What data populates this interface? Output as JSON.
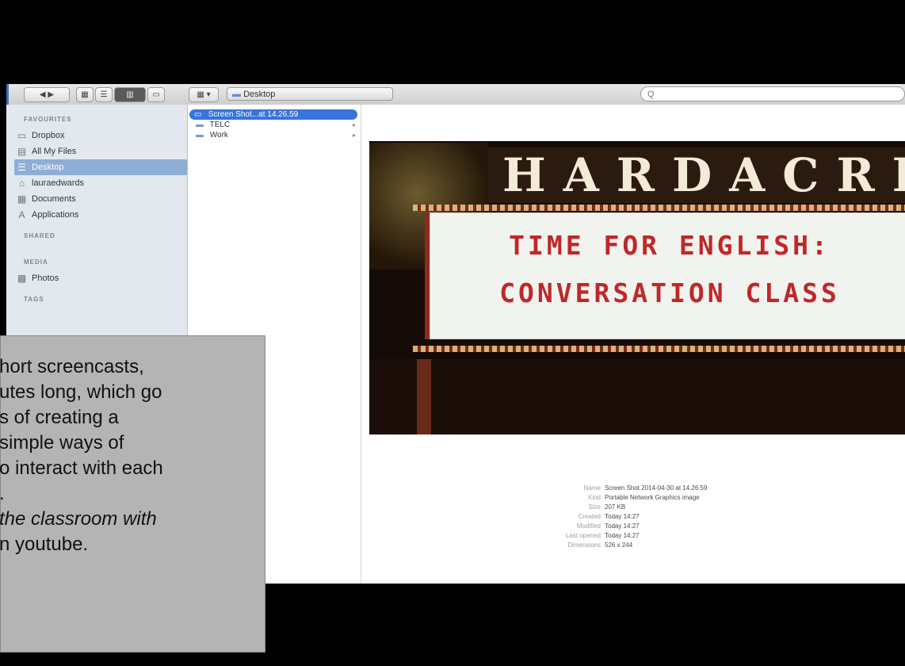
{
  "toolbar": {
    "back_forward": "◀ ▶",
    "view_icons": "▦",
    "view_list": "☰",
    "view_columns": "▥",
    "view_coverflow": "▭",
    "arrange": "▦ ▾",
    "path_label": "Desktop",
    "search_placeholder": "Q"
  },
  "sidebar": {
    "favourites_label": "FAVOURITES",
    "items": [
      {
        "label": "Dropbox",
        "icon": "folder-icon",
        "selected": false
      },
      {
        "label": "All My Files",
        "icon": "files-icon",
        "selected": false
      },
      {
        "label": "Desktop",
        "icon": "desktop-icon",
        "selected": true
      },
      {
        "label": "lauraedwards",
        "icon": "home-icon",
        "selected": false
      },
      {
        "label": "Documents",
        "icon": "documents-icon",
        "selected": false
      },
      {
        "label": "Applications",
        "icon": "applications-icon",
        "selected": false
      }
    ],
    "shared_label": "SHARED",
    "media_label": "MEDIA",
    "media_items": [
      {
        "label": "Photos",
        "icon": "photos-icon"
      }
    ],
    "tags_label": "TAGS"
  },
  "column": {
    "rows": [
      {
        "label": "Screen Shot...at 14.26.59",
        "icon": "image-file-icon",
        "selected": true,
        "has_arrow": false
      },
      {
        "label": "TELC",
        "icon": "folder-icon",
        "selected": false,
        "has_arrow": true
      },
      {
        "label": "Work",
        "icon": "folder-icon",
        "selected": false,
        "has_arrow": true
      }
    ]
  },
  "preview": {
    "sign_top": "HARDACRE",
    "marquee_line1": "TIME FOR ENGLISH:",
    "marquee_line2": "CONVERSATION CLASS",
    "metadata": [
      {
        "key": "Name",
        "value": "Screen Shot 2014-04-30 at 14.26.59"
      },
      {
        "key": "Kind",
        "value": "Portable Network Graphics image"
      },
      {
        "key": "Size",
        "value": "207 KB"
      },
      {
        "key": "Created",
        "value": "Today 14:27"
      },
      {
        "key": "Modified",
        "value": "Today 14:27"
      },
      {
        "key": "Last opened",
        "value": "Today 14:27"
      },
      {
        "key": "Dimensions",
        "value": "526 x 244"
      }
    ]
  },
  "caption": {
    "line1": "hort screencasts,",
    "line2": "utes long, which go",
    "line3": "s of creating a",
    "line4": "simple ways of",
    "line5": "o interact with each",
    "line6": ".",
    "line7": " the classroom with",
    "line8": "n youtube."
  }
}
